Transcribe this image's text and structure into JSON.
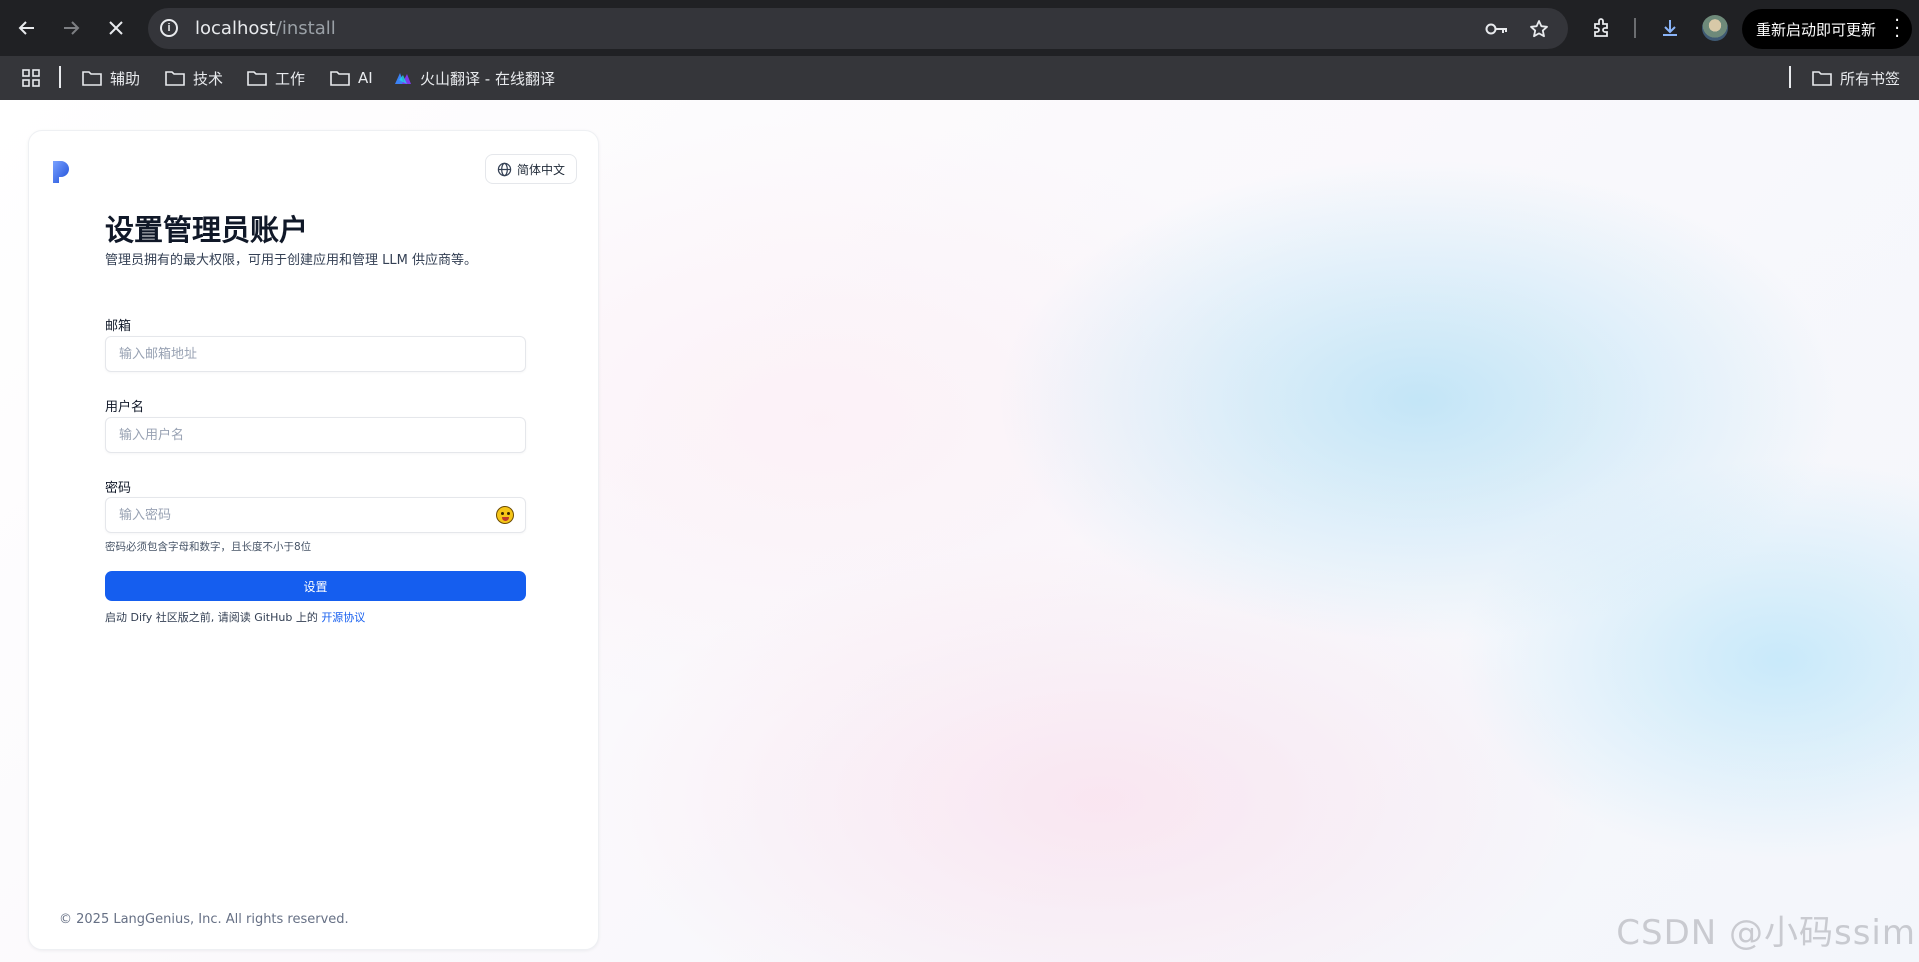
{
  "browser": {
    "url_host": "localhost",
    "url_path": "/install",
    "restart_label": "重新启动即可更新"
  },
  "bookmarks": {
    "items": [
      "辅助",
      "技术",
      "工作",
      "AI",
      "火山翻译 - 在线翻译"
    ],
    "all_bookmarks": "所有书签"
  },
  "card": {
    "language": "简体中文",
    "title": "设置管理员账户",
    "subtitle": "管理员拥有的最大权限，可用于创建应用和管理 LLM 供应商等。",
    "email_label": "邮箱",
    "email_placeholder": "输入邮箱地址",
    "username_label": "用户名",
    "username_placeholder": "输入用户名",
    "password_label": "密码",
    "password_placeholder": "输入密码",
    "password_hint": "密码必须包含字母和数字，且长度不小于8位",
    "submit_label": "设置",
    "agreement_text": "启动 Dify 社区版之前, 请阅读 GitHub 上的 ",
    "agreement_link": "开源协议",
    "footer": "© 2025 LangGenius, Inc. All rights reserved."
  },
  "watermark": "CSDN @小码ssim",
  "colors": {
    "primary": "#155eef",
    "chrome_dark": "#202124",
    "bookmarks_bar": "#35363a"
  }
}
